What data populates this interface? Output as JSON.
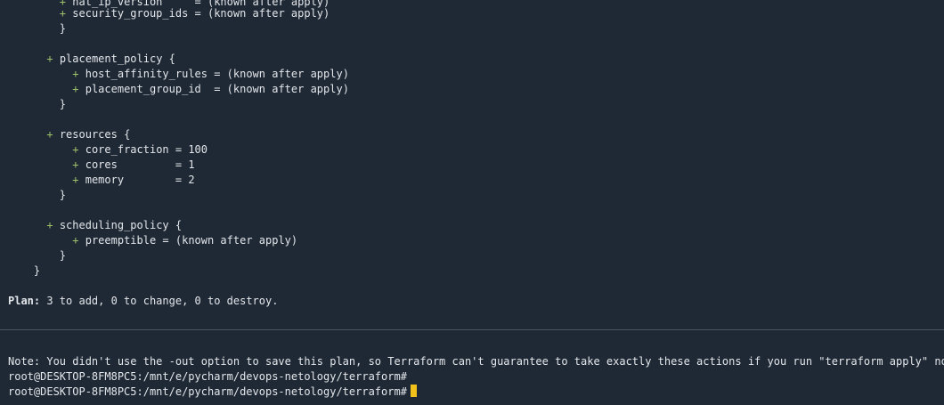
{
  "terminal": {
    "plus": "+",
    "lines": {
      "l0_text": "nat_ip_version     = (known after apply)",
      "l1_text": "security_group_ids = (known after apply)",
      "l2_text": "}",
      "l3_text": "placement_policy {",
      "l4_text": "host_affinity_rules = (known after apply)",
      "l5_text": "placement_group_id  = (known after apply)",
      "l6_text": "}",
      "l7_text": "resources {",
      "l8_text": "core_fraction = 100",
      "l9_text": "cores         = 1",
      "l10_text": "memory        = 2",
      "l11_text": "}",
      "l12_text": "scheduling_policy {",
      "l13_text": "preemptible = (known after apply)",
      "l14_text": "}",
      "l15_text": "}"
    },
    "plan_label": "Plan:",
    "plan_summary": " 3 to add, 0 to change, 0 to destroy.",
    "note": "Note: You didn't use the -out option to save this plan, so Terraform can't guarantee to take exactly these actions if you run \"terraform apply\" now.",
    "prompt1": "root@DESKTOP-8FM8PC5:/mnt/e/pycharm/devops-netology/terraform#",
    "prompt2": "root@DESKTOP-8FM8PC5:/mnt/e/pycharm/devops-netology/terraform#"
  },
  "colors": {
    "background": "#1f2935",
    "text": "#e3e6ea",
    "plus_sign": "#9ec16a",
    "cursor": "#f2c21a"
  }
}
